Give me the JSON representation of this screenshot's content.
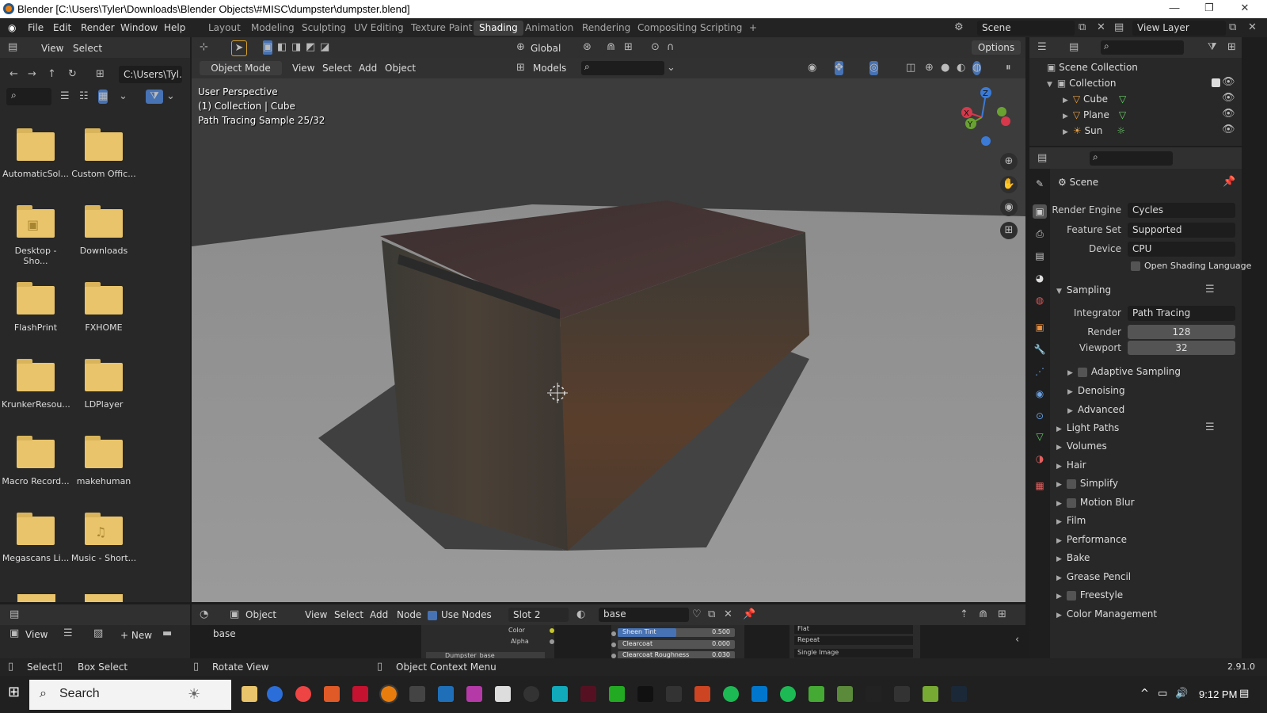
{
  "titlebar": {
    "title": "Blender [C:\\Users\\Tyler\\Downloads\\Blender Objects\\#MISC\\dumpster\\dumpster.blend]",
    "minimize": "—",
    "maximize": "❐",
    "close": "✕"
  },
  "menu": {
    "file": "File",
    "edit": "Edit",
    "render": "Render",
    "window": "Window",
    "help": "Help"
  },
  "workspaces": [
    "Layout",
    "Modeling",
    "Sculpting",
    "UV Editing",
    "Texture Paint",
    "Shading",
    "Animation",
    "Rendering",
    "Compositing",
    "Scripting",
    "+"
  ],
  "active_workspace": "Shading",
  "scene_field": "Scene",
  "view_layer_field": "View Layer",
  "filebrowser": {
    "view": "View",
    "select": "Select",
    "path": "C:\\Users\\Tyl...",
    "items": [
      "AutomaticSol...",
      "Custom Offic...",
      "Desktop - Sho...",
      "Downloads",
      "FlashPrint",
      "FXHOME",
      "KrunkerResou...",
      "LDPlayer",
      "Macro Record...",
      "makehuman",
      "Megascans Li...",
      "Music - Short..."
    ],
    "new_btn": "New",
    "view2": "View"
  },
  "viewport": {
    "global": "Global",
    "options": "Options",
    "mode": "Object Mode",
    "view": "View",
    "select": "Select",
    "add": "Add",
    "object": "Object",
    "models": "Models",
    "overlay_line1": "User Perspective",
    "overlay_line2": "(1) Collection | Cube",
    "overlay_line3": "Path Tracing Sample 25/32",
    "gizmo": {
      "x": "X",
      "y": "Y",
      "z": "Z"
    }
  },
  "outliner": {
    "scene_collection": "Scene Collection",
    "collection": "Collection",
    "items": [
      "Cube",
      "Plane",
      "Sun"
    ]
  },
  "properties": {
    "title": "Scene",
    "render_engine_label": "Render Engine",
    "render_engine": "Cycles",
    "feature_set_label": "Feature Set",
    "feature_set": "Supported",
    "device_label": "Device",
    "device": "CPU",
    "osl": "Open Shading Language",
    "sampling": "Sampling",
    "integrator_label": "Integrator",
    "integrator": "Path Tracing",
    "render_label": "Render",
    "render_value": "128",
    "viewport_label": "Viewport",
    "viewport_value": "32",
    "adaptive": "Adaptive Sampling",
    "denoising": "Denoising",
    "advanced": "Advanced",
    "panels": [
      "Light Paths",
      "Volumes",
      "Hair",
      "Simplify",
      "Motion Blur",
      "Film",
      "Performance",
      "Bake",
      "Grease Pencil",
      "Freestyle",
      "Color Management"
    ]
  },
  "shader_editor": {
    "object": "Object",
    "view": "View",
    "select": "Select",
    "add": "Add",
    "node": "Node",
    "use_nodes": "Use Nodes",
    "slot": "Slot 2",
    "material": "base",
    "node_label": "base",
    "color": "Color",
    "alpha": "Alpha",
    "dumpster_base": "Dumpster_base",
    "sheen_tint": "Sheen Tint",
    "sheen_tint_val": "0.500",
    "sheen_tint_fill": 0.5,
    "clearcoat": "Clearcoat",
    "clearcoat_val": "0.000",
    "clearcoat_rough": "Clearcoat Roughness",
    "clearcoat_rough_val": "0.030",
    "flat": "Flat",
    "repeat": "Repeat",
    "single_image": "Single Image"
  },
  "status": {
    "select": "Select",
    "box_select": "Box Select",
    "rotate": "Rotate View",
    "context": "Object Context Menu",
    "version": "2.91.0"
  },
  "taskbar": {
    "search": "Search",
    "time": "9:12 PM"
  },
  "colors": {
    "accent": "#4772b3",
    "workspace_active": "#3d3d3d",
    "folder": "#e9c46a",
    "rust": "#7a4a2a"
  }
}
